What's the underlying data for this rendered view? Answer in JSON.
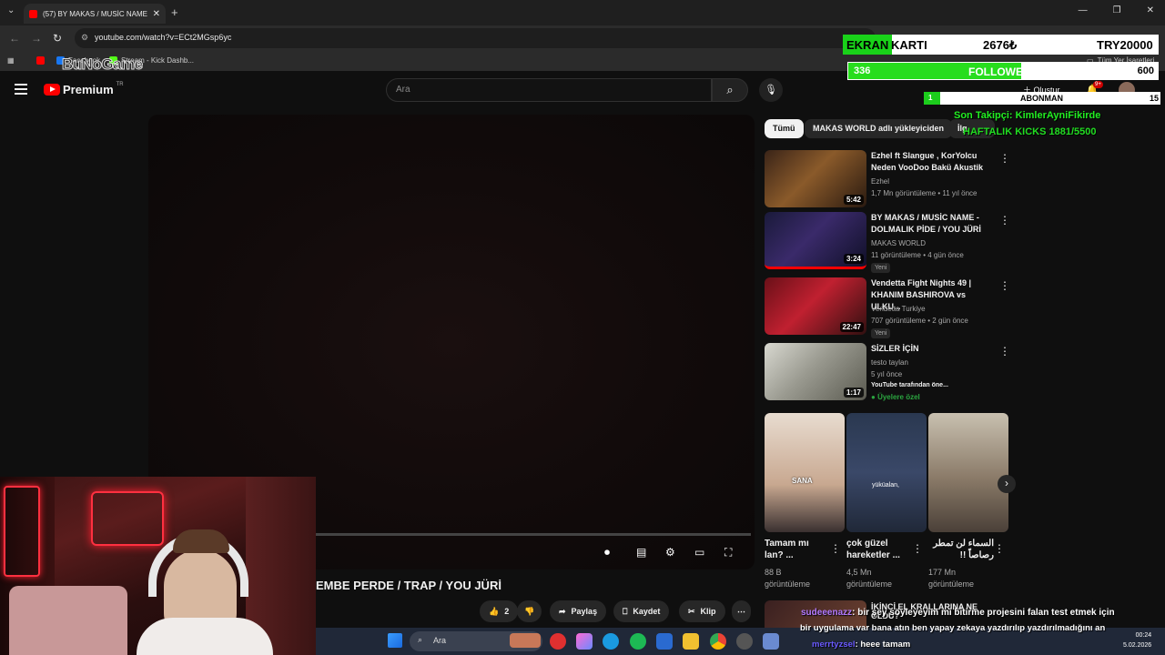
{
  "browser": {
    "tab_title": "(57) BY MAKAS / MUSİC NAME",
    "url": "youtube.com/watch?v=ECt2MGsp6yc",
    "bookmarks": [
      "Facebook",
      "Stream - Kick Dashb..."
    ],
    "all_bookmarks": "Tüm Yer İşaretleri"
  },
  "youtube": {
    "logo_text": "Premium",
    "logo_region": "TR",
    "search_placeholder": "Ara",
    "create_label": "Oluştur",
    "notif_count": "9+",
    "chips": [
      "Tümü",
      "MAKAS WORLD adlı yükleyiciden",
      "İlg"
    ],
    "video_title": "EMBE PERDE / TRAP / YOU JÜRİ",
    "actions": {
      "likes": "2",
      "share": "Paylaş",
      "save": "Kaydet",
      "clip": "Klip"
    },
    "recommendations": [
      {
        "title": "Ezhel ft Slangue , KorYolcu Neden  VooDoo Bakü Akustik",
        "channel": "Ezhel",
        "meta": "1,7 Mn görüntüleme • 11 yıl önce",
        "duration": "5:42",
        "badge": ""
      },
      {
        "title": "BY MAKAS / MUSİC NAME - DOLMALIK PİDE / YOU JÜRİ",
        "channel": "MAKAS WORLD",
        "meta": "11 görüntüleme • 4 gün önce",
        "duration": "3:24",
        "badge": "Yeni"
      },
      {
        "title": "Vendetta Fight Nights 49 | KHANIM BASHIROVA vs ULKU...",
        "channel": "Vendetta Turkiye",
        "meta": "707 görüntüleme • 2 gün önce",
        "duration": "22:47",
        "badge": "Yeni"
      },
      {
        "title": "SİZLER İÇİN",
        "channel": "testo taylan",
        "meta": "5 yıl önce",
        "duration": "1:17",
        "badge": "YouTube tarafından öne...",
        "members": "Üyelere özel"
      }
    ],
    "shorts": [
      {
        "title": "Tamam mı lan? ...",
        "views": "88 B görüntüleme",
        "caption": "SANA"
      },
      {
        "title": "çok güzel hareketler ...",
        "views": "4,5 Mn görüntüleme",
        "caption": "yüküalan,"
      },
      {
        "title": "السماء لن تمطر رصاصاً !!",
        "views": "177 Mn görüntüleme",
        "caption": ""
      }
    ],
    "next_title": "İKİNCİ EL KRALLARINA NE OLDU?"
  },
  "overlay": {
    "ekran_label": "EKRAN",
    "ekran_label2": "KARTI",
    "ekran_value": "2676₺",
    "ekran_target": "TRY20000",
    "followers_current": "336",
    "followers_label": "FOLLOWERS",
    "followers_goal": "600",
    "followers_progress": 0.56,
    "abone_current": "1",
    "abone_label": "ABONMAN",
    "abone_goal": "15",
    "abone_progress": 0.07,
    "son_takipci": "Son Takipçi: KimlerAyniFikirde",
    "haftalik": "HAFTALIK KICKS 1881/5500",
    "brand": "BuNoGame"
  },
  "chat": [
    {
      "user": "sudeeenazz",
      "text": ": bir şey söyleyeyim mi bitirme projesini falan test etmek için"
    },
    {
      "user": "",
      "text": "bir uygulama var bana atın ben yapay zekaya yazdırılıp yazdırılmadığını an"
    },
    {
      "user": "merrtyzsel",
      "text": ": heee tamam"
    }
  ],
  "taskbar": {
    "search": "Ara",
    "time": "00:24",
    "date": "5.02.2026"
  },
  "colors": {
    "yt_red": "#ff0000",
    "overlay_green": "#27dd1d",
    "chat_user": "#b37aff"
  }
}
